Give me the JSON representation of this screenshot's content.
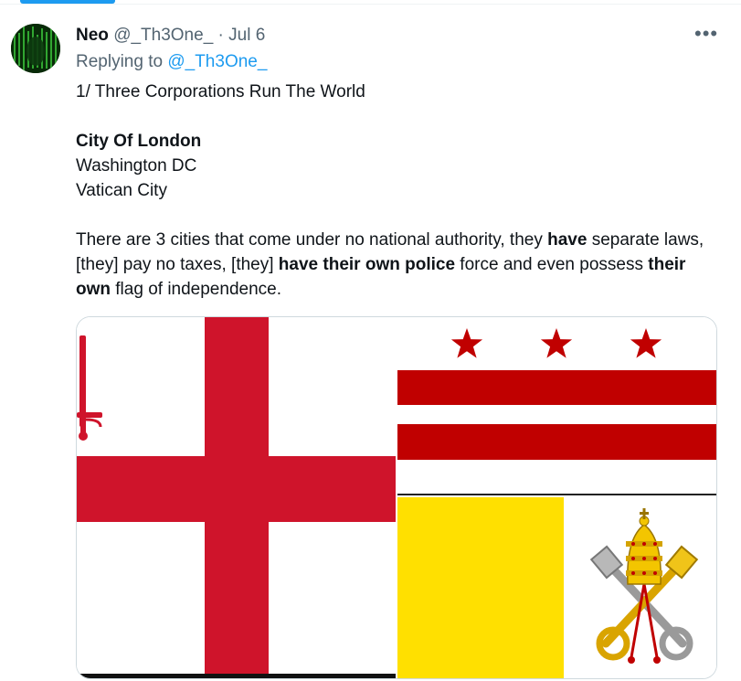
{
  "tweet": {
    "author_name": "Neo",
    "handle": "@_Th3One_",
    "separator": "·",
    "date": "Jul 6",
    "more_label": "•••",
    "replying_prefix": "Replying to",
    "replying_handle": "@_Th3One_",
    "line1": "1/ Three Corporations Run The World",
    "city1": "City Of London",
    "city2": "Washington DC",
    "city3": "Vatican City",
    "para_a": "There are 3 cities that come under no national authority, they ",
    "para_b": "have",
    "para_c": " separate laws, [they] pay no taxes, [they] ",
    "para_d": "have their own police",
    "para_e": " force and even possess ",
    "para_f": "their own",
    "para_g": " flag of independence."
  },
  "colors": {
    "accent": "#1d9bf0",
    "london_red": "#cf142b",
    "dc_red": "#c00000",
    "vatican_yellow": "#ffe000"
  },
  "media": {
    "images": [
      "city-of-london-flag",
      "washington-dc-flag",
      "vatican-city-flag"
    ]
  }
}
